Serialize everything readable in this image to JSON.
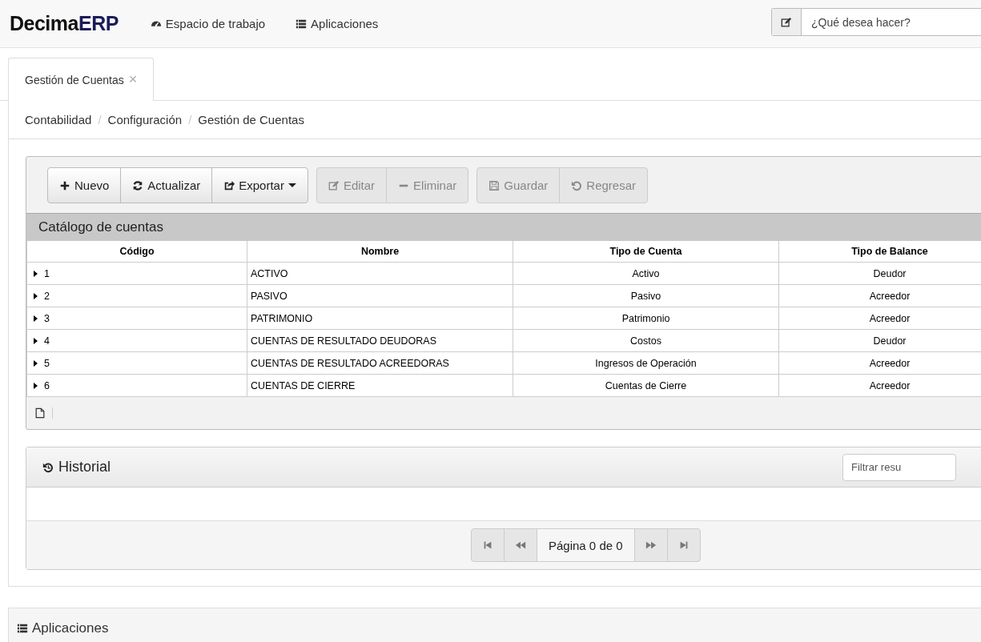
{
  "navbar": {
    "logo": {
      "prefix": "Decima",
      "suffix": "ERP"
    },
    "links": [
      {
        "kind": "dashboard",
        "label": "Espacio de trabajo"
      },
      {
        "kind": "apps",
        "label": "Aplicaciones"
      }
    ],
    "command": {
      "placeholder": "¿Qué desea hacer?"
    }
  },
  "tabs": [
    {
      "label": "Gestión de Cuentas",
      "close": "×"
    }
  ],
  "breadcrumb": {
    "separator": "/",
    "items": [
      "Contabilidad",
      "Configuración",
      "Gestión de Cuentas"
    ]
  },
  "toolbar": {
    "groups": [
      [
        {
          "kind": "plus",
          "label": "Nuevo",
          "disabled": false
        },
        {
          "kind": "refresh",
          "label": "Actualizar",
          "disabled": false
        },
        {
          "kind": "share",
          "label": "Exportar",
          "disabled": false,
          "dropdown": true
        }
      ],
      [
        {
          "kind": "edit",
          "label": "Editar",
          "disabled": true
        },
        {
          "kind": "minus",
          "label": "Eliminar",
          "disabled": true
        }
      ],
      [
        {
          "kind": "save",
          "label": "Guardar",
          "disabled": true
        },
        {
          "kind": "undo",
          "label": "Regresar",
          "disabled": true
        }
      ]
    ]
  },
  "table": {
    "title": "Catálogo de cuentas",
    "columns": [
      "Código",
      "Nombre",
      "Tipo de Cuenta",
      "Tipo de Balance"
    ],
    "rows": [
      {
        "expanded": false,
        "cells": [
          "1",
          "ACTIVO",
          "Activo",
          "Deudor"
        ]
      },
      {
        "expanded": false,
        "cells": [
          "2",
          "PASIVO",
          "Pasivo",
          "Acreedor"
        ]
      },
      {
        "expanded": false,
        "cells": [
          "3",
          "PATRIMONIO",
          "Patrimonio",
          "Acreedor"
        ]
      },
      {
        "expanded": false,
        "cells": [
          "4",
          "CUENTAS DE RESULTADO DEUDORAS",
          "Costos",
          "Deudor"
        ]
      },
      {
        "expanded": false,
        "cells": [
          "5",
          "CUENTAS DE RESULTADO ACREEDORAS",
          "Ingresos de Operación",
          "Acreedor"
        ]
      },
      {
        "expanded": false,
        "cells": [
          "6",
          "CUENTAS DE CIERRE",
          "Cuentas de Cierre",
          "Acreedor"
        ]
      }
    ]
  },
  "history": {
    "title": "Historial",
    "filter": {
      "placeholder": "Filtrar resu"
    },
    "pager": {
      "label": "Página 0 de 0"
    }
  },
  "apps_panel": {
    "title": "Aplicaciones"
  }
}
